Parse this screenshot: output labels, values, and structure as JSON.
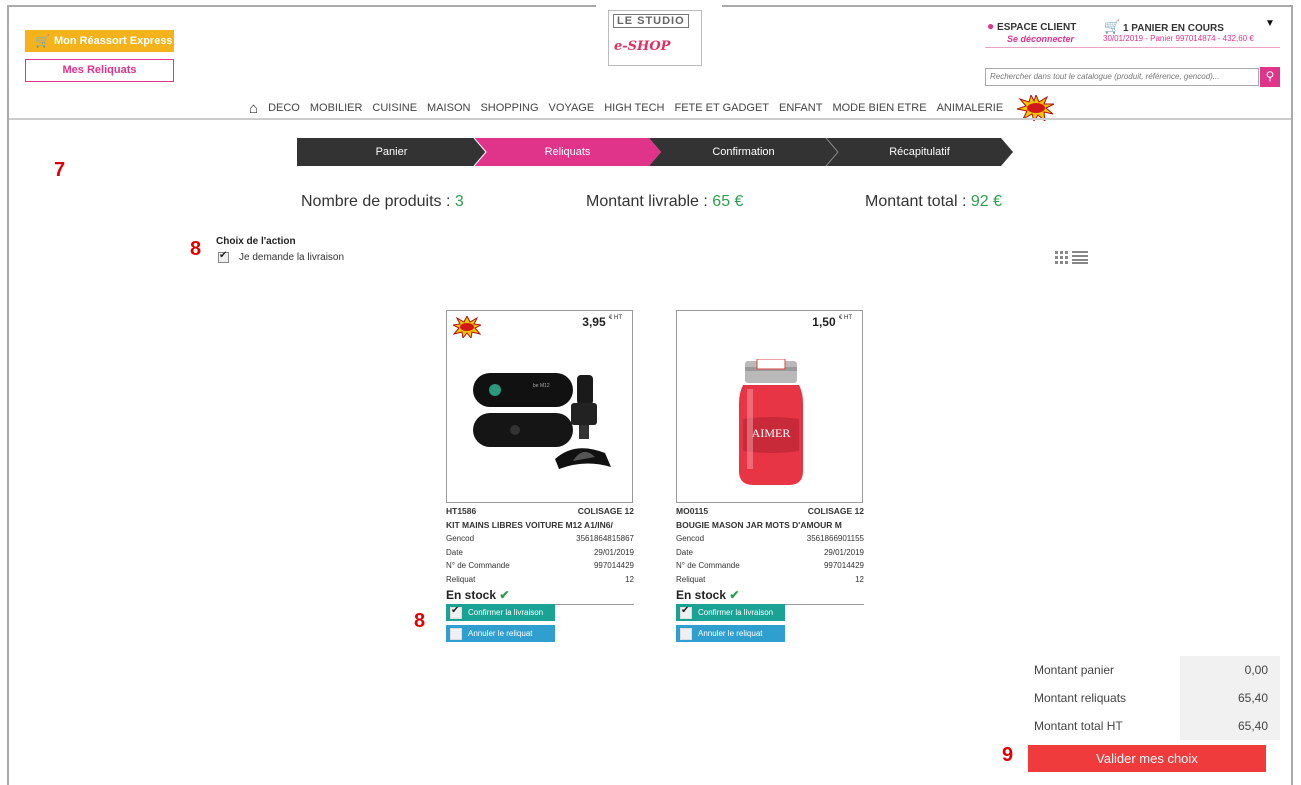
{
  "header": {
    "logo_top": "LE STUDIO",
    "logo_sub": "e-SHOP",
    "express_button": "Mon Réassort Express",
    "reliquats_button": "Mes Reliquats",
    "client_label": "ESPACE CLIENT",
    "logout_label": "Se déconnecter",
    "cart_label": "1 PANIER EN COURS",
    "cart_sub": "30/01/2019 - Panier 997014874 - 432,60 €",
    "search_placeholder": "Rechercher dans tout le catalogue (produit, référence, gencod)..."
  },
  "nav": {
    "items": [
      "DECO",
      "MOBILIER",
      "CUISINE",
      "MAISON",
      "SHOPPING",
      "VOYAGE",
      "HIGH TECH",
      "FETE ET GADGET",
      "ENFANT",
      "MODE BIEN ETRE",
      "ANIMALERIE"
    ]
  },
  "steps": [
    "Panier",
    "Reliquats",
    "Confirmation",
    "Récapitulatif"
  ],
  "annotations": [
    "7",
    "8",
    "8",
    "9"
  ],
  "stats": {
    "products_label": "Nombre de produits :",
    "products_value": "3",
    "deliverable_label": "Montant livrable :",
    "deliverable_value": "65 €",
    "total_label": "Montant total :",
    "total_value": "92 €"
  },
  "choice": {
    "title": "Choix de l'action",
    "option": "Je demande la livraison"
  },
  "products": [
    {
      "price": "3,95",
      "price_unit": "€ HT",
      "ref": "HT1586",
      "colisage": "COLISAGE 12",
      "name": "KIT MAINS LIBRES VOITURE M12 A1/IN6/",
      "gencod_label": "Gencod",
      "gencod": "3561864815867",
      "date_label": "Date",
      "date": "29/01/2019",
      "order_label": "N° de Commande",
      "order": "997014429",
      "reliquat_label": "Reliquat",
      "reliquat": "12",
      "stock": "En stock",
      "confirm": "Confirmer la livraison",
      "cancel": "Annuler le reliquat"
    },
    {
      "price": "1,50",
      "price_unit": "€ HT",
      "ref": "MO0115",
      "colisage": "COLISAGE 12",
      "name": "BOUGIE MASON JAR MOTS D'AMOUR M",
      "gencod_label": "Gencod",
      "gencod": "3561866901155",
      "date_label": "Date",
      "date": "29/01/2019",
      "order_label": "N° de Commande",
      "order": "997014429",
      "reliquat_label": "Reliquat",
      "reliquat": "12",
      "stock": "En stock",
      "confirm": "Confirmer la livraison",
      "cancel": "Annuler le reliquat",
      "jar_text": "AIMER"
    }
  ],
  "totals": [
    {
      "label": "Montant panier",
      "value": "0,00"
    },
    {
      "label": "Montant reliquats",
      "value": "65,40"
    },
    {
      "label": "Montant total HT",
      "value": "65,40"
    }
  ],
  "validate_button": "Valider mes choix",
  "colors": {
    "accent": "#e0338a",
    "step_dark": "#333333",
    "green": "#1aa394",
    "blue": "#2f9fd0",
    "red": "#ef3b3b"
  }
}
